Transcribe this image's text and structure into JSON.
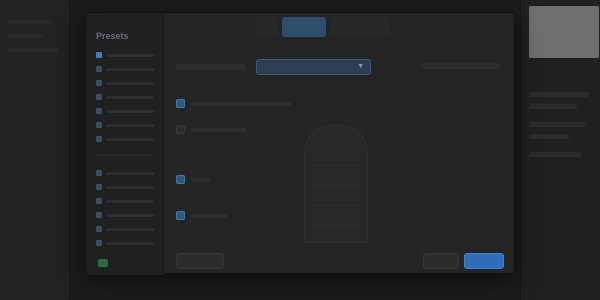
{
  "dialog": {
    "sidebar_title": "Presets",
    "tabs": [
      "",
      "",
      ""
    ],
    "toolbar": {
      "label": "",
      "select_value": ""
    },
    "options": [
      {
        "label": "",
        "checked": true
      },
      {
        "label": "",
        "checked": false
      },
      {
        "label": "",
        "checked": true
      },
      {
        "label": "",
        "checked": true
      }
    ],
    "buttons": {
      "reset": "",
      "cancel": "",
      "ok": ""
    }
  },
  "colors": {
    "accent": "#2f6dbb",
    "dialog_bg": "#242424",
    "app_bg": "#1c1c1c"
  }
}
